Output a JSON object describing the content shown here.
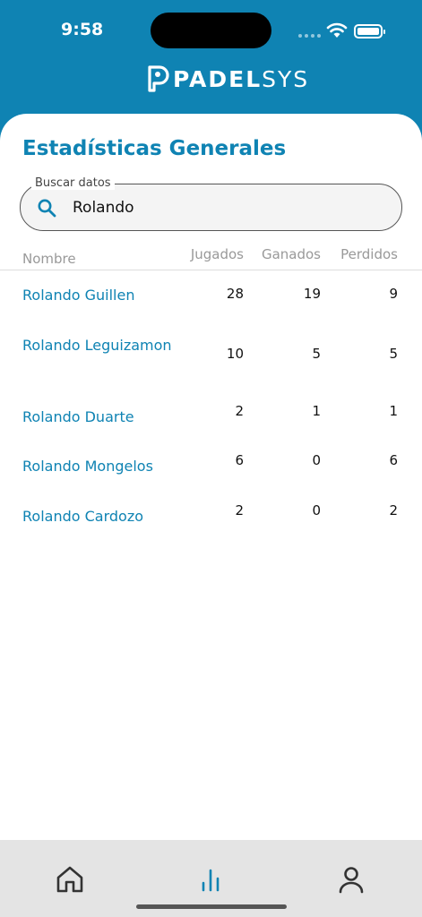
{
  "status_bar": {
    "time": "9:58"
  },
  "brand": {
    "logo_text_bold": "PADEL",
    "logo_text_light": "SYS"
  },
  "page": {
    "title": "Estadísticas Generales"
  },
  "search": {
    "label": "Buscar datos",
    "value": "Rolando"
  },
  "table": {
    "headers": {
      "name": "Nombre",
      "played": "Jugados",
      "won": "Ganados",
      "lost": "Perdidos"
    },
    "rows": [
      {
        "name": "Rolando Guillen",
        "played": "28",
        "won": "19",
        "lost": "9"
      },
      {
        "name": "Rolando Leguizamon",
        "played": "10",
        "won": "5",
        "lost": "5"
      },
      {
        "name": "Rolando Duarte",
        "played": "2",
        "won": "1",
        "lost": "1"
      },
      {
        "name": "Rolando Mongelos",
        "played": "6",
        "won": "0",
        "lost": "6"
      },
      {
        "name": "Rolando Cardozo",
        "played": "2",
        "won": "0",
        "lost": "2"
      }
    ]
  },
  "nav": {
    "items": [
      "home-icon",
      "bar-chart-icon",
      "user-icon"
    ]
  },
  "colors": {
    "primary": "#0f83b3",
    "nav_bg": "#e4e4e4"
  }
}
